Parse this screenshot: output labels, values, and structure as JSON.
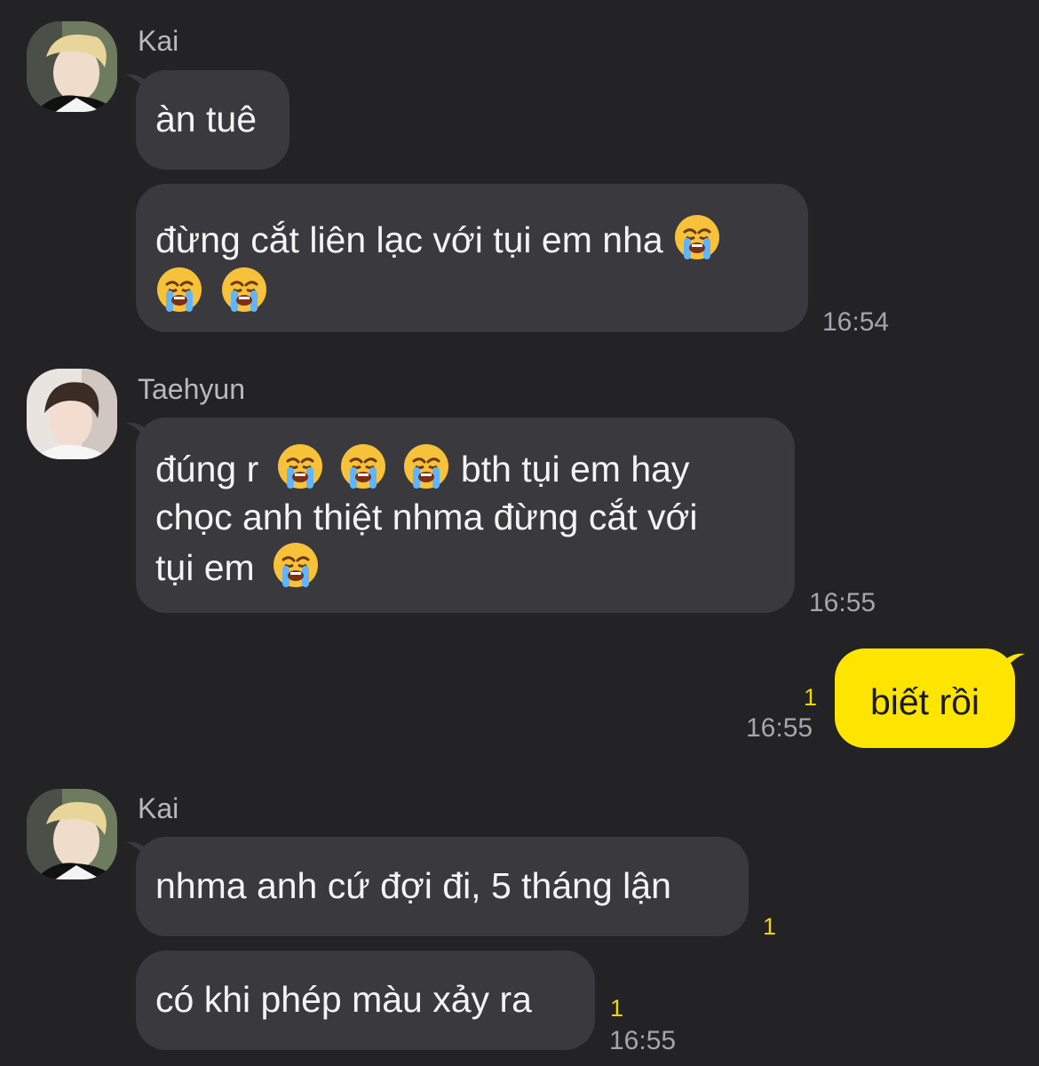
{
  "colors": {
    "background": "#232326",
    "bubble_other": "#3a3a3e",
    "bubble_me": "#fee500",
    "unread": "#f5d800"
  },
  "groups": [
    {
      "sender": "Kai",
      "avatar": "kai-avatar",
      "messages": [
        {
          "text": "àn tuê"
        },
        {
          "text": "đừng cắt liên lạc với tụi em nha 😭 😭 😭",
          "time": "16:54"
        }
      ]
    },
    {
      "sender": "Taehyun",
      "avatar": "taehyun-avatar",
      "messages": [
        {
          "text": "đúng r 😭 😭 😭 bth tụi em hay chọc anh thiệt nhma đừng cắt với tụi em 😭",
          "time": "16:55"
        }
      ]
    },
    {
      "sender": "me",
      "messages": [
        {
          "text": "biết rồi",
          "time": "16:55",
          "unread": "1"
        }
      ]
    },
    {
      "sender": "Kai",
      "avatar": "kai-avatar",
      "messages": [
        {
          "text": "nhma anh cứ đợi đi, 5 tháng lận",
          "unread": "1"
        },
        {
          "text": "có khi phép màu xảy ra",
          "unread": "1",
          "time": "16:55"
        }
      ]
    }
  ]
}
